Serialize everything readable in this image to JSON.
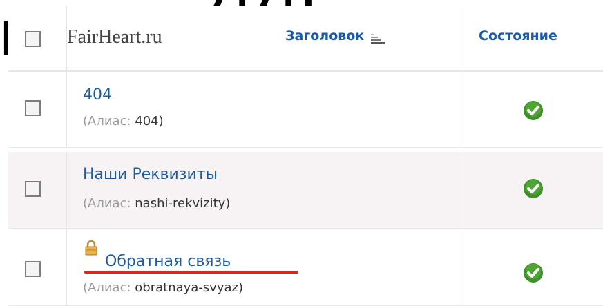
{
  "background": {
    "top_letters": "ДДР",
    "left_letter": "М"
  },
  "header": {
    "site_name": "FairHeart.ru",
    "title_column": "Заголовок",
    "state_column": "Состояние"
  },
  "rows": [
    {
      "title": "404",
      "alias_label": "(Алиас:",
      "alias_value": "404)",
      "published": true,
      "locked": false
    },
    {
      "title": "Наши Реквизиты",
      "alias_label": "(Алиас:",
      "alias_value": "nashi-rekvizity)",
      "published": true,
      "locked": false
    },
    {
      "title": "Обратная связь",
      "alias_label": "(Алиас:",
      "alias_value": "obratnaya-svyaz)",
      "published": true,
      "locked": true
    }
  ],
  "colors": {
    "link": "#1e5b9c",
    "header_link": "#1a5aa8",
    "published_green": "#3f8f2a",
    "highlight_underline": "#e2231a"
  }
}
